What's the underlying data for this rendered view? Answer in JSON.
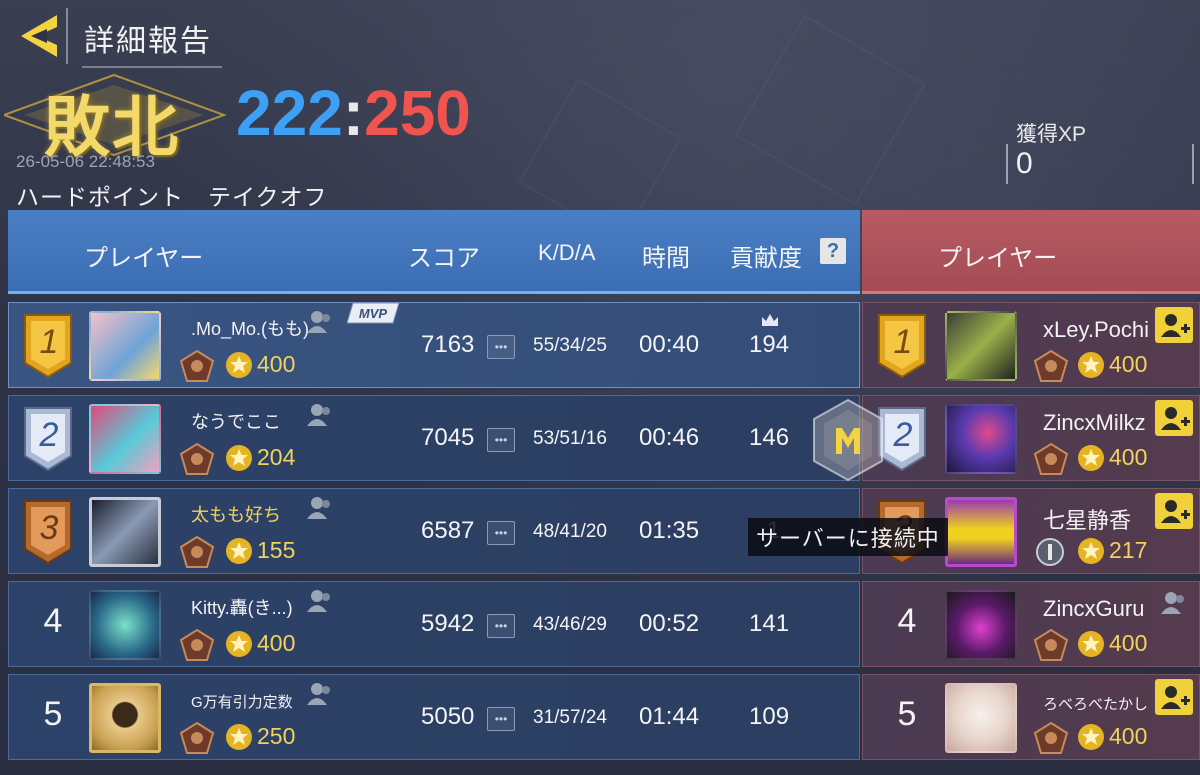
{
  "header": {
    "title": "詳細報告",
    "result": "敗北",
    "score_blue": "222",
    "score_separator": ":",
    "score_red": "250",
    "timestamp": "26-05-06 22:48:53",
    "mode": "ハードポイント　テイクオフ",
    "xp_label": "獲得XP",
    "xp_value": "0"
  },
  "columns": {
    "player": "プレイヤー",
    "score": "スコア",
    "kda": "K/D/A",
    "time": "時間",
    "contribution": "貢献度",
    "help": "?",
    "enemy_player": "プレイヤー"
  },
  "mvp_label": "MVP",
  "colors": {
    "team_blue": "#3ea0f5",
    "team_red": "#f0544e",
    "gold": "#f0d25c",
    "add_button": "#f1d13a"
  },
  "blue_team": [
    {
      "rank": "1",
      "name": ".Mo_Mo.(もも)",
      "rating": "400",
      "score": "7163",
      "kda": "55/34/25",
      "time": "00:40",
      "contribution": "194"
    },
    {
      "rank": "2",
      "name": "なうでここ",
      "rating": "204",
      "score": "7045",
      "kda": "53/51/16",
      "time": "00:46",
      "contribution": "146"
    },
    {
      "rank": "3",
      "name": "太もも好ち",
      "rating": "155",
      "score": "6587",
      "kda": "48/41/20",
      "time": "01:35",
      "contribution": "1"
    },
    {
      "rank": "4",
      "name": "Kitty.轟(き...)",
      "rating": "400",
      "score": "5942",
      "kda": "43/46/29",
      "time": "00:52",
      "contribution": "141"
    },
    {
      "rank": "5",
      "name": "G万有引力定数",
      "rating": "250",
      "score": "5050",
      "kda": "31/57/24",
      "time": "01:44",
      "contribution": "109"
    }
  ],
  "red_team": [
    {
      "rank": "1",
      "name": "xLey.Pochi",
      "rating": "400"
    },
    {
      "rank": "2",
      "name": "ZincxMilkz",
      "rating": "400"
    },
    {
      "rank": "3",
      "name": "七星静香",
      "rating": "217"
    },
    {
      "rank": "4",
      "name": "ZincxGuru",
      "rating": "400"
    },
    {
      "rank": "5",
      "name": "ろべろべたかし",
      "rating": "400"
    }
  ],
  "overlay": {
    "connecting_text": "サーバーに接続中"
  }
}
